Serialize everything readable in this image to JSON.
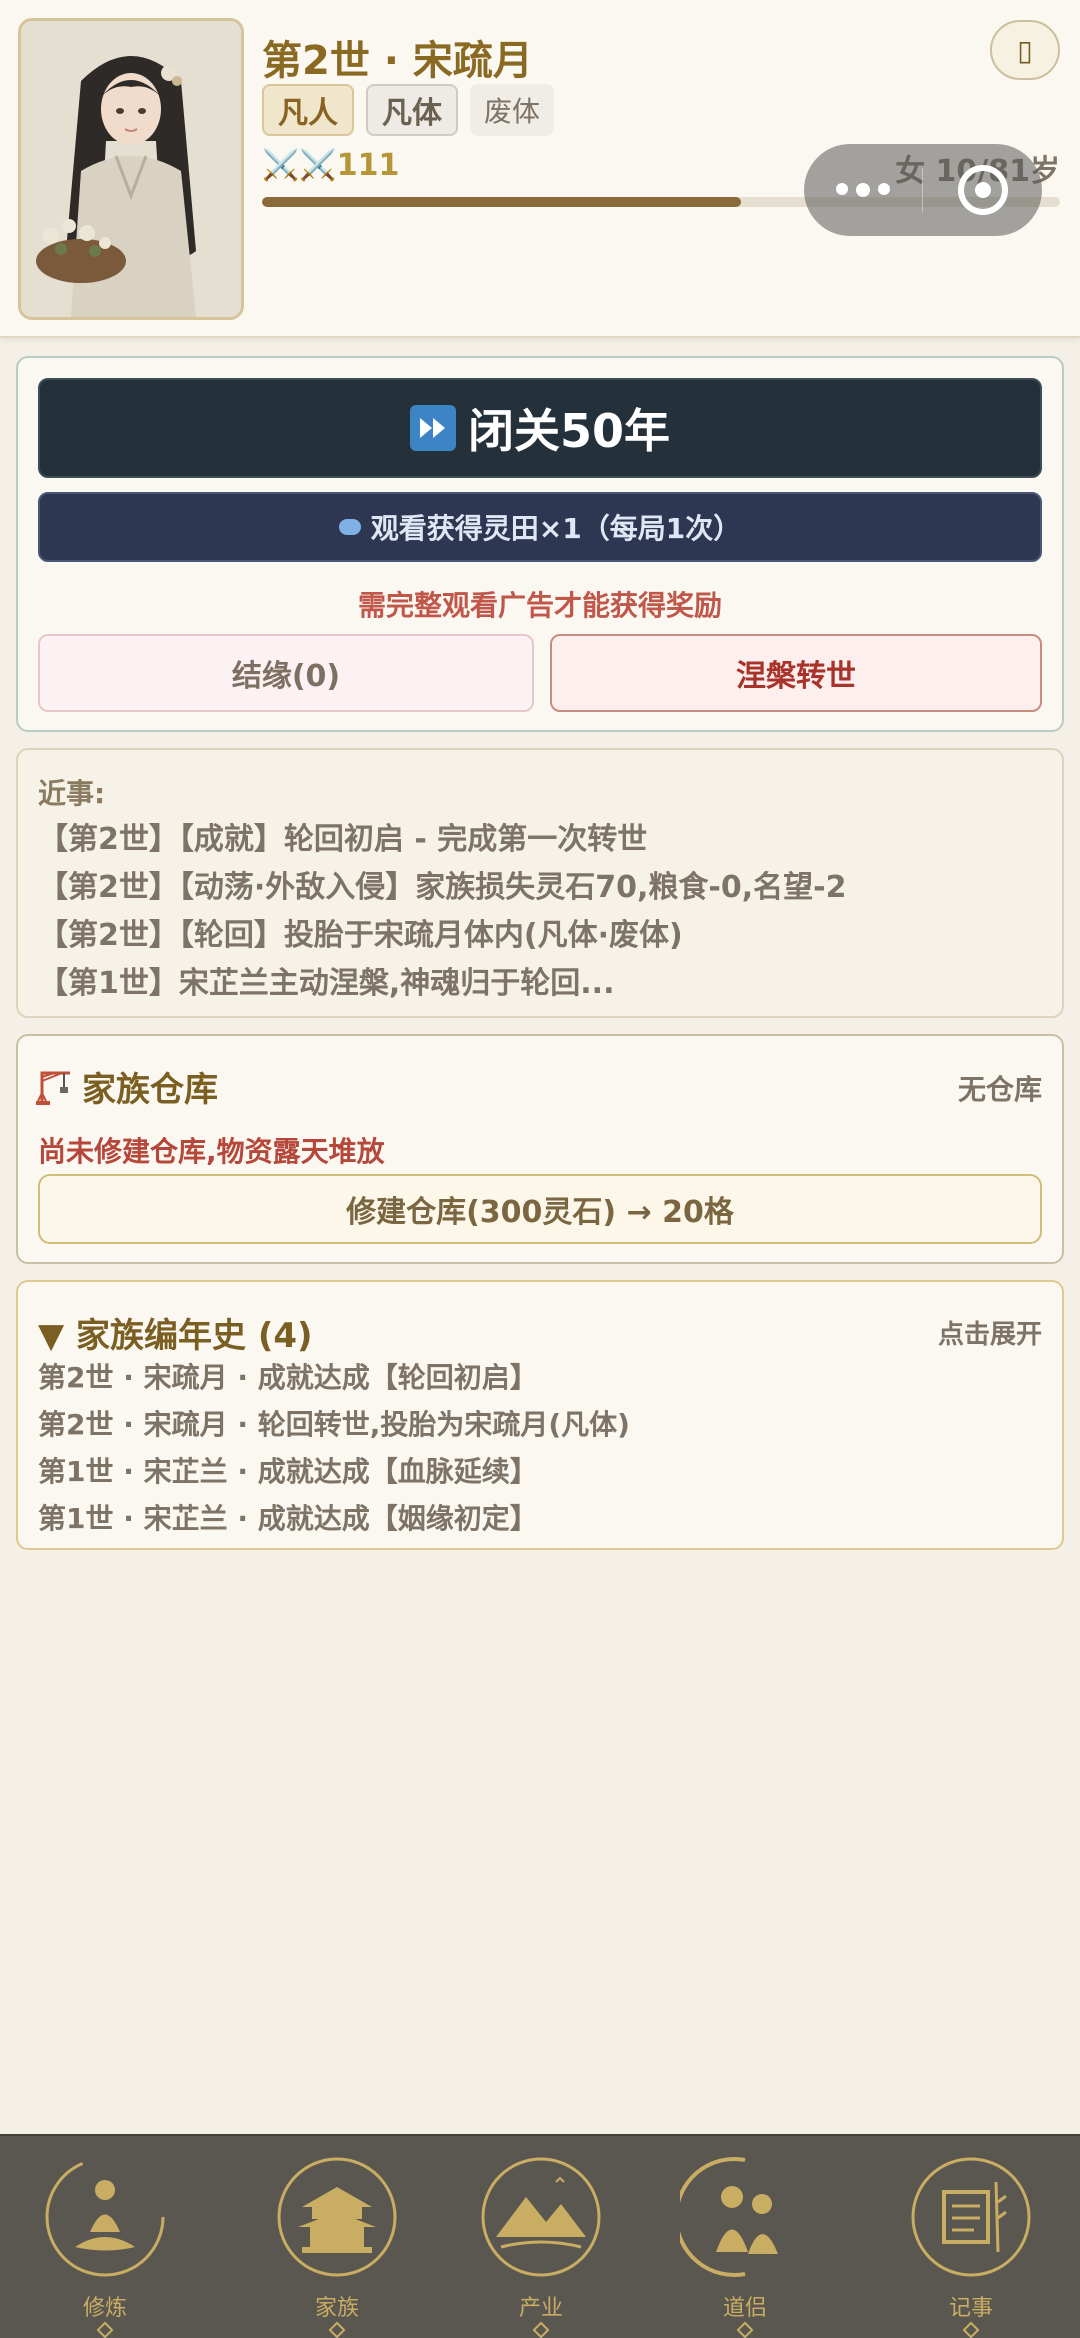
{
  "header": {
    "title": "第2世 · 宋疏月",
    "tags": [
      "凡人",
      "凡体",
      "废体"
    ],
    "power": "⚔️⚔️111",
    "age": "女 10/81岁",
    "progress": 0.6,
    "info_icon": "info-icon"
  },
  "actions": {
    "seclude_label": "闭关50年",
    "ad_label": "观看获得灵田×1（每局1次）",
    "ad_note": "需完整观看广告才能获得奖励",
    "marriage_label": "结缘(0)",
    "reborn_label": "涅槃转世"
  },
  "recent": {
    "title": "近事:",
    "items": [
      "【第2世】【成就】轮回初启 - 完成第一次转世",
      "【第2世】【动荡·外敌入侵】家族损失灵石70,粮食-0,名望-2",
      "【第2世】【轮回】投胎于宋疏月体内(凡体·废体)",
      "【第1世】宋芷兰主动涅槃,神魂归于轮回..."
    ]
  },
  "warehouse": {
    "title": "家族仓库",
    "status": "无仓库",
    "note": "尚未修建仓库,物资露天堆放",
    "build_label": "修建仓库(300灵石) → 20格"
  },
  "chronicle": {
    "title": "▼ 家族编年史 (4)",
    "expand": "点击展开",
    "items": [
      "第2世 · 宋疏月 · 成就达成【轮回初启】",
      "第2世 · 宋疏月 · 轮回转世,投胎为宋疏月(凡体)",
      "第1世 · 宋芷兰 · 成就达成【血脉延续】",
      "第1世 · 宋芷兰 · 成就达成【姻缘初定】"
    ]
  },
  "nav": {
    "items": [
      {
        "label": "修炼",
        "icon": "meditation-icon"
      },
      {
        "label": "家族",
        "icon": "pavilion-icon"
      },
      {
        "label": "产业",
        "icon": "mountain-landscape-icon"
      },
      {
        "label": "道侣",
        "icon": "couple-icon"
      },
      {
        "label": "记事",
        "icon": "scroll-icon"
      }
    ]
  },
  "colors": {
    "accent_gold": "#8a6a22",
    "dark_button": "#24303a",
    "ad_button": "#2d3752",
    "danger_red": "#a8332a",
    "nav_bg": "#5a5750"
  }
}
